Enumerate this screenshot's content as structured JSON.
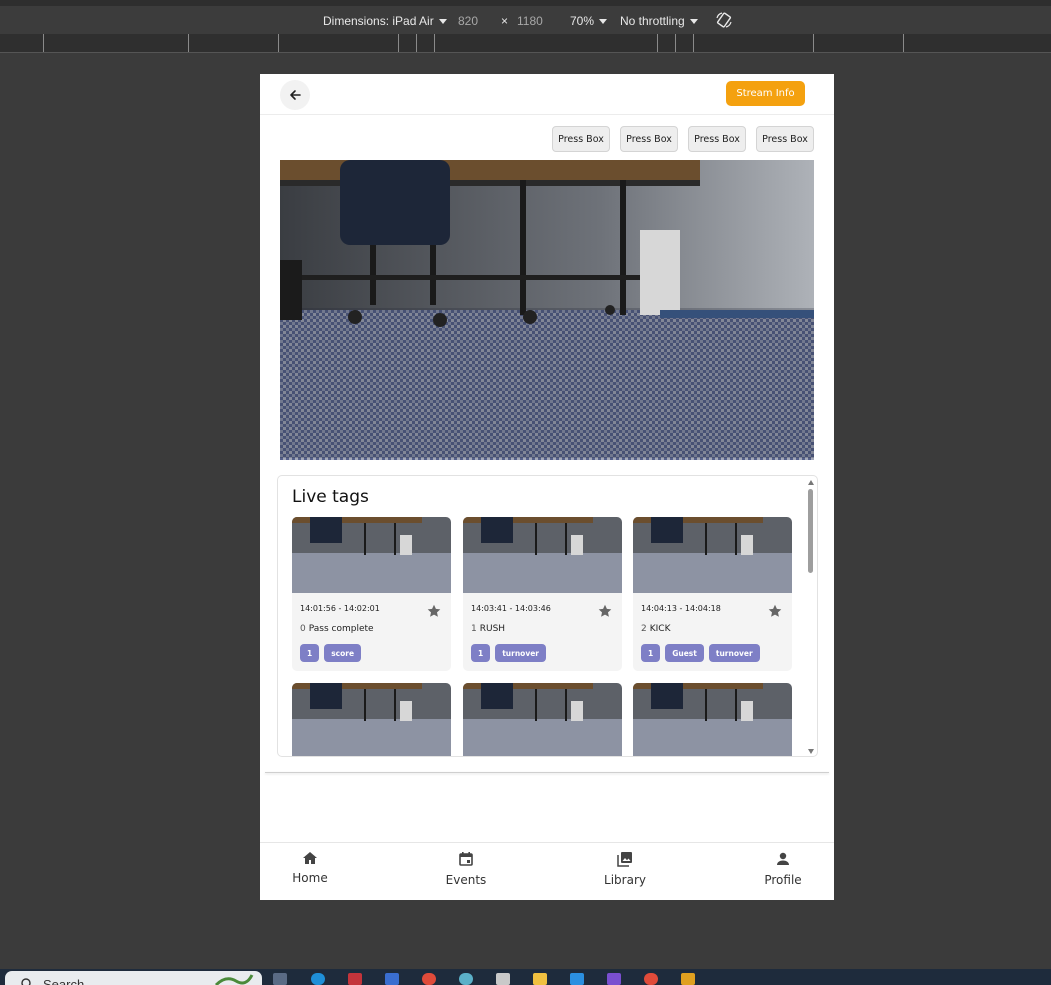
{
  "devtools": {
    "dimensions_label": "Dimensions: iPad Air",
    "width": "820",
    "times": "×",
    "height": "1180",
    "zoom": "70%",
    "throttling": "No throttling",
    "rotate_icon": "rotate-icon"
  },
  "app": {
    "back_icon": "arrow-left-icon",
    "stream_info_label": "Stream Info",
    "camera_buttons": [
      "Press Box",
      "Press Box",
      "Press Box",
      "Press Box"
    ],
    "live_tags": {
      "title": "Live tags",
      "cards": [
        {
          "time": "14:01:56 - 14:02:01",
          "index": "0",
          "label": "Pass complete",
          "chips": [
            "1",
            "score"
          ]
        },
        {
          "time": "14:03:41 - 14:03:46",
          "index": "1",
          "label": "RUSH",
          "chips": [
            "1",
            "turnover"
          ]
        },
        {
          "time": "14:04:13 - 14:04:18",
          "index": "2",
          "label": "KICK",
          "chips": [
            "1",
            "Guest",
            "turnover"
          ]
        }
      ]
    },
    "nav": [
      {
        "label": "Home",
        "icon": "home-icon"
      },
      {
        "label": "Events",
        "icon": "calendar-icon"
      },
      {
        "label": "Library",
        "icon": "photo-library-icon"
      },
      {
        "label": "Profile",
        "icon": "person-icon"
      }
    ]
  },
  "taskbar": {
    "search_label": "Search"
  },
  "colors": {
    "accent": "#f4a10f",
    "chip": "#7e7fc6",
    "backdrop": "#3b3b3b"
  }
}
